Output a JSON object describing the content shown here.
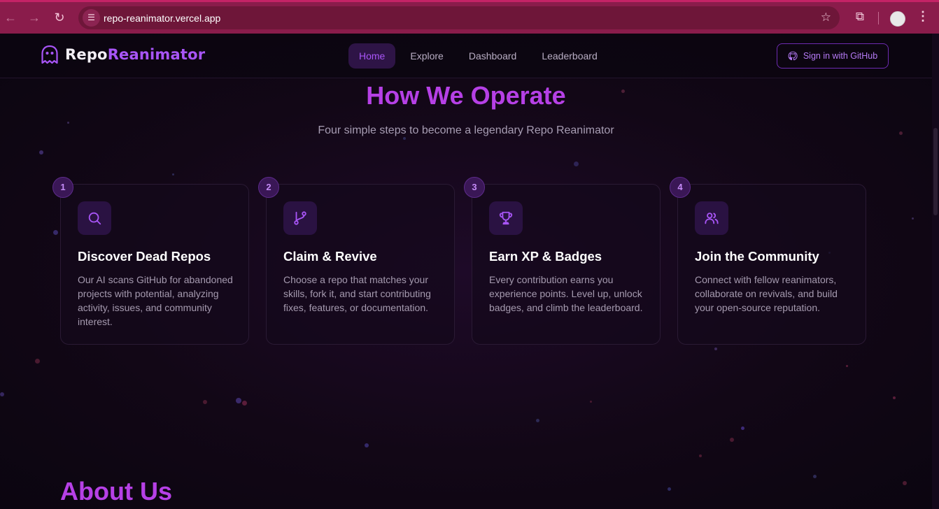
{
  "browser": {
    "url": "repo-reanimator.vercel.app"
  },
  "header": {
    "brand_part1": "Repo",
    "brand_part2": "Reanimator",
    "nav": [
      "Home",
      "Explore",
      "Dashboard",
      "Leaderboard"
    ],
    "active_nav": "Home",
    "signin_label": "Sign in with GitHub"
  },
  "section": {
    "title": "How We Operate",
    "subtitle": "Four simple steps to become a legendary Repo Reanimator",
    "steps": [
      {
        "num": "1",
        "icon": "search-icon",
        "title": "Discover Dead Repos",
        "text": "Our AI scans GitHub for abandoned projects with potential, analyzing activity, issues, and community interest."
      },
      {
        "num": "2",
        "icon": "git-branch-icon",
        "title": "Claim & Revive",
        "text": "Choose a repo that matches your skills, fork it, and start contributing fixes, features, or documentation."
      },
      {
        "num": "3",
        "icon": "trophy-icon",
        "title": "Earn XP & Badges",
        "text": "Every contribution earns you experience points. Level up, unlock badges, and climb the leaderboard."
      },
      {
        "num": "4",
        "icon": "users-icon",
        "title": "Join the Community",
        "text": "Connect with fellow reanimators, collaborate on revivals, and build your open-source reputation."
      }
    ]
  },
  "about": {
    "title": "About Us"
  },
  "colors": {
    "accent": "#a855f7",
    "heading": "#b640e6",
    "chrome": "#8a1c4b"
  }
}
